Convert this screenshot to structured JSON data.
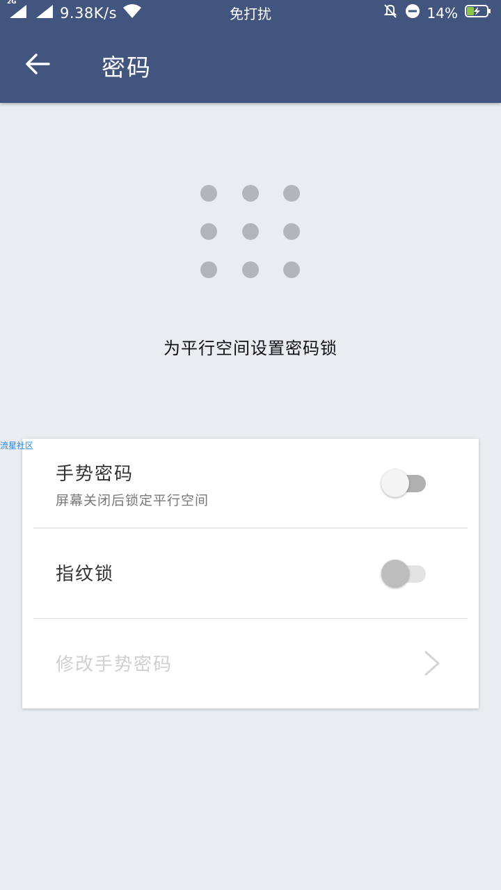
{
  "status_bar": {
    "network_type": "2G",
    "speed": "9.38K/s",
    "mode": "免打扰",
    "battery": "14%"
  },
  "header": {
    "title": "密码"
  },
  "pattern_hint": "为平行空间设置密码锁",
  "watermark": "流星社区",
  "settings": {
    "gesture": {
      "title": "手势密码",
      "subtitle": "屏幕关闭后锁定平行空间",
      "enabled": false
    },
    "fingerprint": {
      "title": "指纹锁",
      "enabled": false
    },
    "change_gesture": {
      "title": "修改手势密码",
      "disabled": true
    }
  },
  "colors": {
    "header_bg": "#42557E",
    "page_bg": "#E9ECF1",
    "dot": "#B3B5BA",
    "toggle1_track": "#B0B0B0",
    "toggle2_track": "#E3E3E3",
    "toggle1_thumb": "#F4F4F4",
    "toggle2_thumb": "#BDBDBD"
  }
}
